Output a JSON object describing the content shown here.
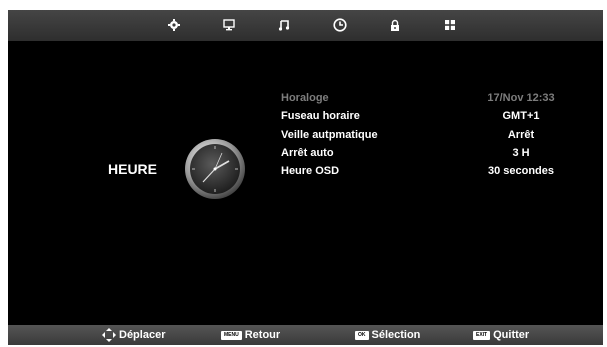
{
  "menu_icons": [
    {
      "name": "settings-icon"
    },
    {
      "name": "picture-icon"
    },
    {
      "name": "music-icon"
    },
    {
      "name": "clock-icon"
    },
    {
      "name": "lock-icon"
    },
    {
      "name": "apps-icon"
    }
  ],
  "active_menu": "clock-icon",
  "section_title": "HEURE",
  "settings": [
    {
      "label": "Horaloge",
      "value": "17/Nov  12:33",
      "state": "disabled"
    },
    {
      "label": "Fuseau horaire",
      "value": "GMT+1",
      "state": "normal"
    },
    {
      "label": "Veille autpmatique",
      "value": "Arrêt",
      "state": "normal"
    },
    {
      "label": "Arrêt auto",
      "value": "3 H",
      "state": "normal"
    },
    {
      "label": "Heure OSD",
      "value": "30 secondes",
      "state": "normal"
    }
  ],
  "footer": {
    "move": {
      "label": "Déplacer"
    },
    "menu": {
      "key": "MENU",
      "label": "Retour"
    },
    "ok": {
      "key": "OK",
      "label": "Sélection"
    },
    "exit": {
      "key": "EXIT",
      "label": "Quitter"
    }
  },
  "colors": {
    "background": "#000000",
    "bar": "#3c3c3c",
    "text": "#ffffff",
    "disabled_text": "#7d7d7d"
  }
}
